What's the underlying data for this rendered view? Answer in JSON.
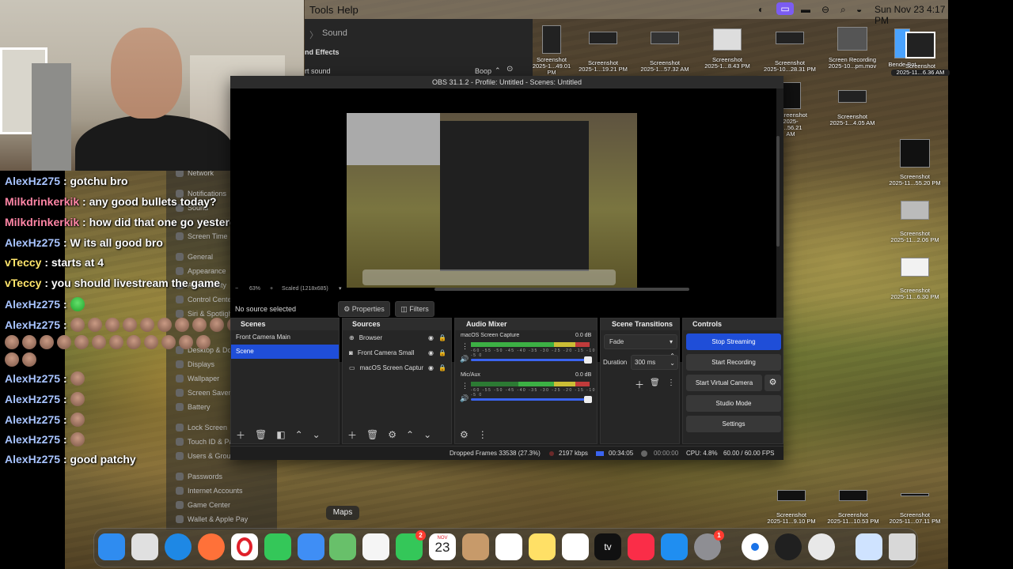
{
  "menubar": {
    "items": [
      "Tools",
      "Help"
    ],
    "datetime": "Sun Nov 23  4:17 PM"
  },
  "chat": [
    {
      "name": "AlexHz275",
      "msg": ": gotchu bro",
      "color": "blue"
    },
    {
      "name": "Milkdrinkerkik",
      "msg": ": any good bullets today?",
      "color": "pink"
    },
    {
      "name": "Milkdrinkerkik",
      "msg": ": how did that one go yesterday",
      "color": "pink"
    },
    {
      "name": "AlexHz275",
      "msg": ": W its all good bro",
      "color": "blue"
    },
    {
      "name": "vTeccy",
      "msg": ": starts at 4",
      "color": "yel"
    },
    {
      "name": "vTeccy",
      "msg": ": you should livestream the game",
      "color": "yel"
    },
    {
      "name": "AlexHz275",
      "msg": ":",
      "color": "blue"
    },
    {
      "name": "AlexHz275",
      "msg": ":",
      "color": "blue"
    },
    {
      "name": "AlexHz275",
      "msg": ":",
      "color": "blue"
    },
    {
      "name": "AlexHz275",
      "msg": ":",
      "color": "blue"
    },
    {
      "name": "AlexHz275",
      "msg": ":",
      "color": "blue"
    },
    {
      "name": "AlexHz275",
      "msg": ":",
      "color": "blue"
    },
    {
      "name": "AlexHz275",
      "msg": ": good patchy",
      "color": "blue"
    }
  ],
  "system_settings": {
    "items": [
      "Network",
      "Notifications",
      "Sound",
      "Screen Time",
      "General",
      "Appearance",
      "Accessibility",
      "Control Center",
      "Siri & Spotlight",
      "Desktop & Dock",
      "Displays",
      "Wallpaper",
      "Screen Saver",
      "Battery",
      "Lock Screen",
      "Touch ID & Password",
      "Users & Groups",
      "Passwords",
      "Internet Accounts",
      "Game Center",
      "Wallet & Apple Pay"
    ]
  },
  "sound_window": {
    "title": "Sound",
    "section": "nd Effects",
    "alert_label": "rt sound",
    "alert_value": "Boop"
  },
  "obs": {
    "title": "OBS 31.1.2 - Profile: Untitled - Scenes: Untitled",
    "zoom": "63%",
    "scaled": "Scaled (1218x685)",
    "no_source": "No source selected",
    "properties_label": "Properties",
    "filters_label": "Filters",
    "scenes": {
      "header": "Scenes",
      "items": [
        "Front Camera Main",
        "Scene"
      ],
      "selected": 1
    },
    "sources": {
      "header": "Sources",
      "items": [
        "Browser",
        "Front Camera Small",
        "macOS Screen Capture"
      ]
    },
    "audio_mixer": {
      "header": "Audio Mixer",
      "channels": [
        {
          "name": "macOS Screen Capture",
          "db": "0.0 dB",
          "scale": "-60 -55 -50 -45 -40 -35 -30 -25 -20 -15 -10 -5 0"
        },
        {
          "name": "Mic/Aux",
          "db": "0.0 dB",
          "scale": "-60 -55 -50 -45 -40 -35 -30 -25 -20 -15 -10 -5 0"
        }
      ]
    },
    "transitions": {
      "header": "Scene Transitions",
      "type": "Fade",
      "duration_label": "Duration",
      "duration_value": "300 ms"
    },
    "controls": {
      "header": "Controls",
      "stop_streaming": "Stop Streaming",
      "start_recording": "Start Recording",
      "start_virtual_camera": "Start Virtual Camera",
      "studio_mode": "Studio Mode",
      "settings": "Settings"
    },
    "status": {
      "dropped_frames": "Dropped Frames 33538 (27.3%)",
      "bitrate": "2197 kbps",
      "stream_time": "00:34:05",
      "rec_time": "00:00:00",
      "cpu": "CPU: 4.8%",
      "fps": "60.00 / 60.00 FPS"
    }
  },
  "desktop_icons": [
    {
      "line1": "Screenshot",
      "line2": "2025-1...49.01 PM"
    },
    {
      "line1": "Screenshot",
      "line2": "2025-1...19.21 PM"
    },
    {
      "line1": "Screenshot",
      "line2": "2025-1...57.32 AM"
    },
    {
      "line1": "Screenshot",
      "line2": "2025-1...8.43 PM"
    },
    {
      "line1": "Screenshot",
      "line2": "2025-10...28.31 PM"
    },
    {
      "line1": "Screen Recording",
      "line2": "2025-10...pm.mov"
    },
    {
      "line1": "Bende Bot",
      "line2": "Screenshot"
    },
    {
      "line1": "Screenshot",
      "line2": "2025-11...6.36 AM"
    },
    {
      "line1": "Screenshot",
      "line2": "2025-1...56.21 AM"
    },
    {
      "line1": "Screenshot",
      "line2": "2025-1...4.05 AM"
    },
    {
      "line1": "Screenshot",
      "line2": "2025-11...55.20 PM"
    },
    {
      "line1": "Screenshot",
      "line2": "2025-11...2.06 PM"
    },
    {
      "line1": "Screenshot",
      "line2": "2025-11...6.30 PM"
    },
    {
      "line1": "Screenshot",
      "line2": "2025-11...9.10 PM"
    },
    {
      "line1": "Screenshot",
      "line2": "2025-11...10.53 PM"
    },
    {
      "line1": "Screenshot",
      "line2": "2025-11...07.11 PM"
    }
  ],
  "dock": {
    "tooltip": "Maps",
    "apps": [
      {
        "name": "Finder",
        "color": "#2f8cf0"
      },
      {
        "name": "Launchpad",
        "color": "#e0e0e0"
      },
      {
        "name": "Safari",
        "color": "#1e88e5"
      },
      {
        "name": "Firefox",
        "color": "#ff7139"
      },
      {
        "name": "Opera",
        "color": "#ffffff"
      },
      {
        "name": "Messages",
        "color": "#34c759"
      },
      {
        "name": "Mail",
        "color": "#3f8ef5"
      },
      {
        "name": "Maps",
        "color": "#68c06a"
      },
      {
        "name": "Photos",
        "color": "#f5f5f5"
      },
      {
        "name": "FaceTime",
        "color": "#34c759",
        "badge": "2"
      },
      {
        "name": "Calendar",
        "color": "#ffffff",
        "month": "NOV",
        "day": "23"
      },
      {
        "name": "Contacts",
        "color": "#c79a6a"
      },
      {
        "name": "Reminders",
        "color": "#ffffff"
      },
      {
        "name": "Notes",
        "color": "#ffe066"
      },
      {
        "name": "Freeform",
        "color": "#ffffff"
      },
      {
        "name": "TV",
        "color": "#111111",
        "label": "tv"
      },
      {
        "name": "Music",
        "color": "#fa2d48"
      },
      {
        "name": "App Store",
        "color": "#1f8ef1"
      },
      {
        "name": "System Settings",
        "color": "#8e8e93",
        "badge": "1"
      },
      {
        "name": "Chrome",
        "color": "#ffffff"
      },
      {
        "name": "OBS",
        "color": "#202020"
      },
      {
        "name": "QuickTime",
        "color": "#e8e8e8"
      },
      {
        "name": "Preview",
        "color": "#cfe3ff"
      },
      {
        "name": "Trash",
        "color": "#d8d8d8"
      }
    ]
  }
}
